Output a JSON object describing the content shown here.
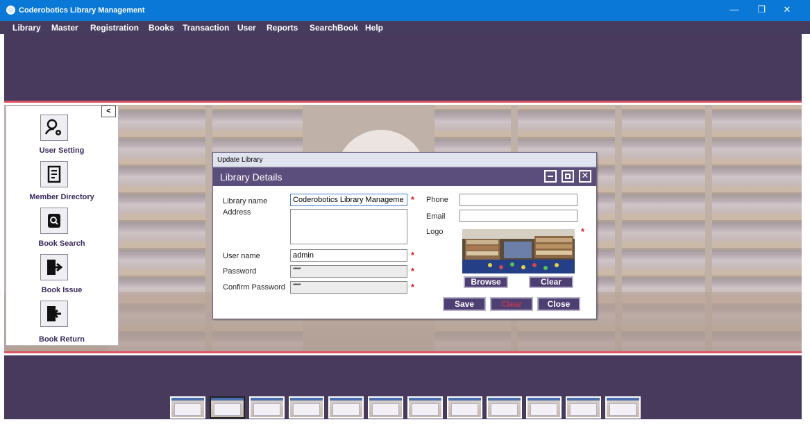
{
  "window": {
    "title": "Coderobotics Library Management"
  },
  "menu": [
    "Library",
    "Master",
    "Registration",
    "Books",
    "Transaction",
    "User",
    "Reports",
    "SearchBook",
    "Help"
  ],
  "sidebar": {
    "collapse_label": "<",
    "items": [
      {
        "label": "User Setting",
        "icon": "user-gear-icon"
      },
      {
        "label": "Member Directory",
        "icon": "directory-icon"
      },
      {
        "label": "Book Search",
        "icon": "search-icon"
      },
      {
        "label": "Book Issue",
        "icon": "issue-icon"
      },
      {
        "label": "Book Return",
        "icon": "return-icon"
      }
    ]
  },
  "dialog": {
    "window_title": "Update Library",
    "header": "Library Details",
    "fields": {
      "library_name_label": "Library name",
      "library_name_value": "Coderobotics Library Manageme",
      "address_label": "Address",
      "address_value": "",
      "username_label": "User name",
      "username_value": "admin",
      "password_label": "Password",
      "password_value": "*****",
      "confirm_password_label": "Confirm Password",
      "confirm_password_value": "*****",
      "phone_label": "Phone",
      "phone_value": "",
      "email_label": "Email",
      "email_value": "",
      "logo_label": "Logo"
    },
    "required_mark": "*",
    "buttons": {
      "browse": "Browse",
      "clear_logo": "Clear",
      "save": "Save",
      "clear": "Clear",
      "close": "Close"
    }
  },
  "thumbnails": {
    "count": 12,
    "active_index": 1
  }
}
